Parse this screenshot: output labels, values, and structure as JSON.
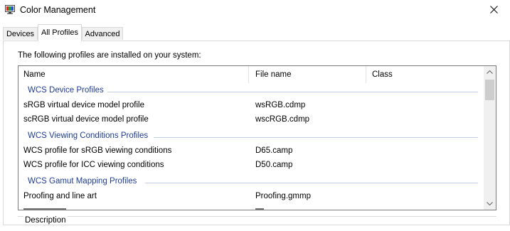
{
  "window": {
    "title": "Color Management",
    "icon": "monitor-color-icon",
    "close_icon": "close-icon"
  },
  "tabs": [
    {
      "label": "Devices",
      "active": false
    },
    {
      "label": "All Profiles",
      "active": true
    },
    {
      "label": "Advanced",
      "active": false
    }
  ],
  "intro_text": "The following profiles are installed on your system:",
  "columns": [
    "Name",
    "File name",
    "Class"
  ],
  "groups": [
    {
      "label": "WCS Device Profiles",
      "rows": [
        {
          "name": "sRGB virtual device model profile",
          "file": "wsRGB.cdmp",
          "class": ""
        },
        {
          "name": "scRGB virtual device model profile",
          "file": "wscRGB.cdmp",
          "class": ""
        }
      ]
    },
    {
      "label": "WCS Viewing Conditions Profiles",
      "rows": [
        {
          "name": "WCS profile for sRGB viewing conditions",
          "file": "D65.camp",
          "class": ""
        },
        {
          "name": "WCS profile for ICC viewing conditions",
          "file": "D50.camp",
          "class": ""
        }
      ]
    },
    {
      "label": "WCS Gamut Mapping Profiles",
      "rows": [
        {
          "name": "Proofing and line art",
          "file": "Proofing.gmmp",
          "class": ""
        }
      ]
    }
  ],
  "description_label": "Description",
  "colors": {
    "group_label": "#1e3c96",
    "accent": "#0078d7"
  }
}
